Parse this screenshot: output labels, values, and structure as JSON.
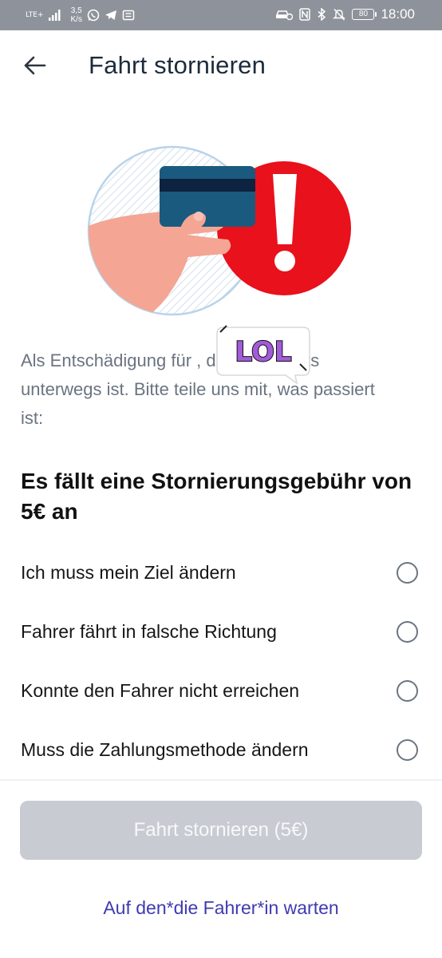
{
  "status_bar": {
    "network": "LTE+",
    "speed_value": "3,5",
    "speed_unit": "K/s",
    "battery": "80",
    "time": "18:00",
    "icons": [
      "signal-icon",
      "whatsapp-icon",
      "telegram-icon",
      "message-icon",
      "car-icon",
      "nfc-icon",
      "bluetooth-icon",
      "mute-icon",
      "battery-icon"
    ]
  },
  "header": {
    "back_icon": "back-arrow-icon",
    "title": "Fahrt stornieren"
  },
  "illustration": {
    "description_icon": "card-warning-illustration",
    "colors": {
      "alert": "#e8111c",
      "card": "#1a5a7e",
      "card_stripe": "#0d2340",
      "hand": "#f4a594",
      "circle_stroke": "#b9d3ea"
    }
  },
  "sticker": {
    "text": "LOL",
    "colors": {
      "fill": "#a25bd9",
      "bubble": "#ffffff"
    }
  },
  "description": {
    "text": "Als Entschädigung für                     , der*die bereits unterwegs ist. Bitte teile uns mit, was passiert ist:"
  },
  "fee_heading": "Es fällt eine Stornierungsgebühr von 5€ an",
  "reasons": [
    {
      "label": "Ich muss mein Ziel ändern",
      "selected": false
    },
    {
      "label": "Fahrer fährt in falsche Richtung",
      "selected": false
    },
    {
      "label": "Konnte den Fahrer nicht erreichen",
      "selected": false
    },
    {
      "label": "Muss die Zahlungsmethode ändern",
      "selected": false
    }
  ],
  "actions": {
    "cancel_label": "Fahrt stornieren (5€)",
    "cancel_enabled": false,
    "wait_label": "Auf den*die Fahrer*in warten"
  },
  "colors": {
    "status_bar": "#8e939b",
    "title": "#1c2b3c",
    "link": "#3f3ab1",
    "disabled_button": "#c8ccd2"
  }
}
